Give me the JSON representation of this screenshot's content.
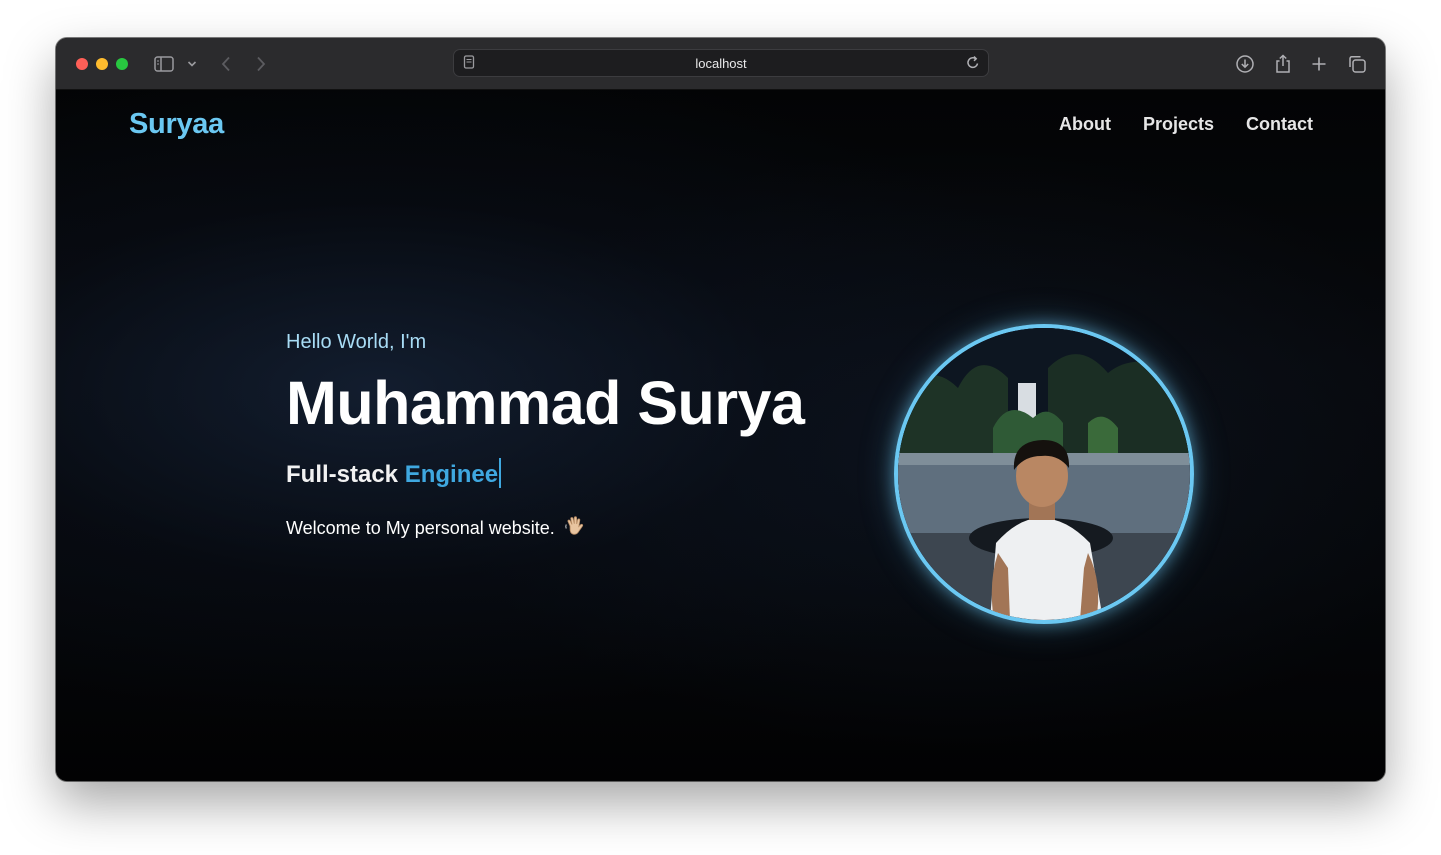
{
  "browser": {
    "url": "localhost",
    "icons": [
      "sidebar-icon",
      "chevron-down-icon",
      "back-icon",
      "forward-icon",
      "page-icon",
      "reload-icon",
      "download-icon",
      "share-icon",
      "plus-icon",
      "tabs-icon"
    ]
  },
  "site": {
    "logo": "Suryaa",
    "nav": [
      "About",
      "Projects",
      "Contact"
    ],
    "hero": {
      "greeting": "Hello World, I'm",
      "name": "Muhammad Surya",
      "role_prefix": "Full-stack",
      "role_typed": "Enginee",
      "welcome": "Welcome to My personal website."
    }
  },
  "colors": {
    "accent": "#6bc8f2",
    "accent_strong": "#3fa8e0",
    "background": "#05070a"
  }
}
